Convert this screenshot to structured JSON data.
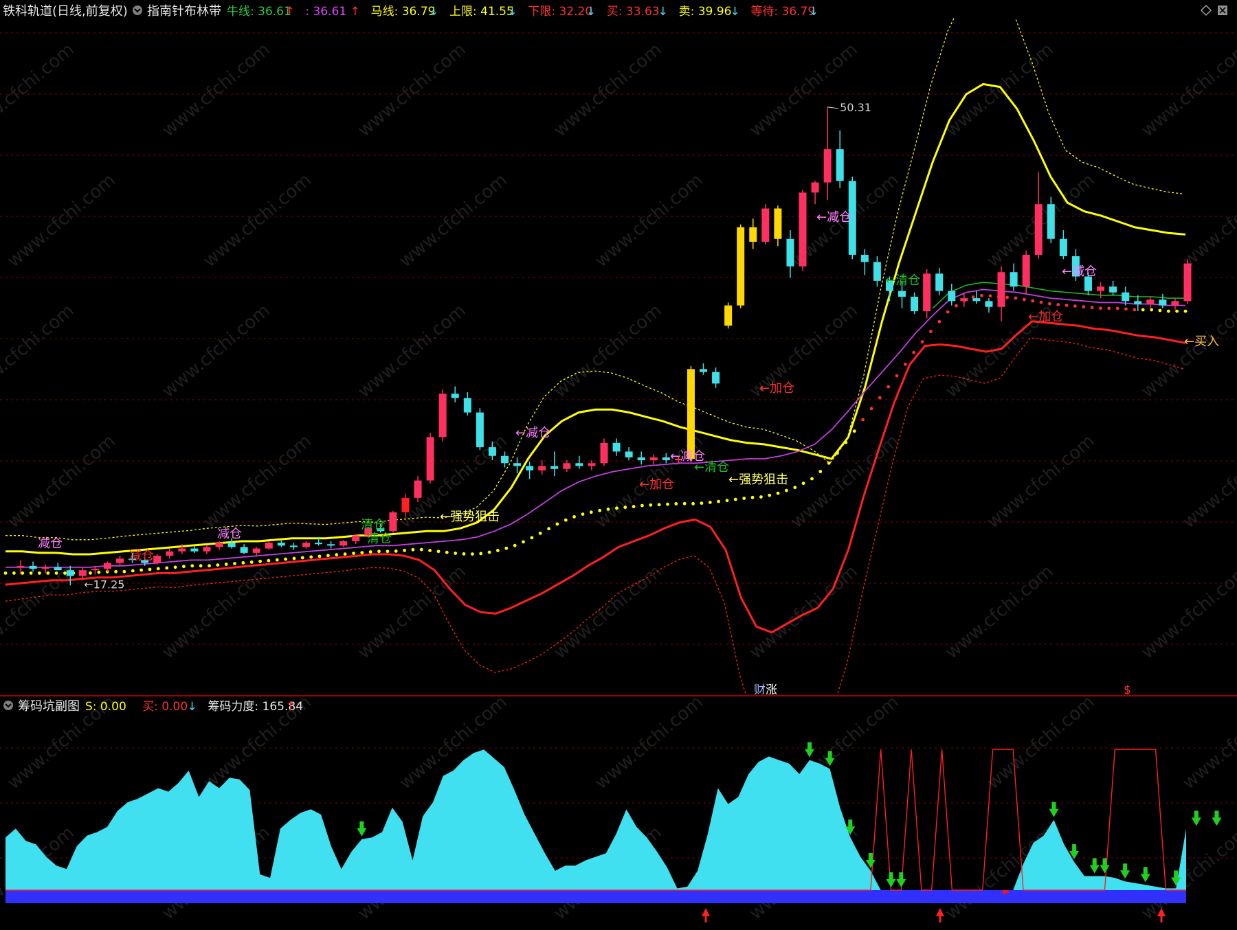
{
  "app": {
    "title": "铁科轨道(日线,前复权)"
  },
  "main_header": {
    "indicator_name": "指南针布林带",
    "items": [
      {
        "label": "牛线",
        "value": ": 36.61",
        "arrow": "↑",
        "color": "#2ecc40",
        "arrow_color": "#ff3030"
      },
      {
        "label": "",
        "value": ": 36.61",
        "arrow": "↑",
        "color": "#e040fb",
        "arrow_color": "#ff3030"
      },
      {
        "label": "马线",
        "value": ": 36.79",
        "arrow": "↓",
        "color": "#ffff00",
        "arrow_color": "#40e0ff"
      },
      {
        "label": "上限",
        "value": ": 41.55",
        "arrow": "↓",
        "color": "#ffff00",
        "arrow_color": "#40e0ff"
      },
      {
        "label": "下限",
        "value": ": 32.20",
        "arrow": "↓",
        "color": "#ff3030",
        "arrow_color": "#40e0ff"
      },
      {
        "label": "买",
        "value": ": 33.63",
        "arrow": "↓",
        "color": "#ff3030",
        "arrow_color": "#40e0ff"
      },
      {
        "label": "卖",
        "value": ": 39.96",
        "arrow": "↓",
        "color": "#ffff00",
        "arrow_color": "#40e0ff"
      },
      {
        "label": "等待",
        "value": ": 36.79",
        "arrow": "↓",
        "color": "#ff3030",
        "arrow_color": "#40e0ff"
      }
    ]
  },
  "sub_header": {
    "indicator_name": "筹码坑副图",
    "items": [
      {
        "label": "S",
        "value": ": 0.00",
        "arrow": "",
        "color": "#ffff00"
      },
      {
        "label": "买",
        "value": ": 0.00",
        "arrow": "↓",
        "color": "#ff3030",
        "arrow_color": "#40e0ff"
      },
      {
        "label": "筹码力度",
        "value": ": 165.84",
        "arrow": "↑",
        "color": "#e8e8e8",
        "arrow_color": "#ff3030"
      }
    ]
  },
  "watermark": "www.cfchi.com",
  "colors": {
    "background": "#000000",
    "up_candle": "#ff3060",
    "down_candle": "#40e0e8",
    "yellow_candle": "#ffd800",
    "upper_band": "#ffff00",
    "lower_band": "#ff2020",
    "magenta_line": "#c040e0",
    "green_line": "#20c020",
    "dotted_line": "#ffff00",
    "grid": "#8b0000",
    "area_fill": "#40e0f0",
    "blue_bar": "#3030ff",
    "red_area": "#ff1010"
  },
  "chart_data": [
    {
      "type": "candlestick",
      "title": "指南针布林带",
      "ylim": [
        10,
        56
      ],
      "price_labels": [
        {
          "text": "50.31"
        },
        {
          "text": "17.25"
        }
      ],
      "candles": [
        [
          18.5,
          19.0,
          18.0,
          18.6
        ],
        [
          18.6,
          18.9,
          18.2,
          18.4
        ],
        [
          18.4,
          18.7,
          18.1,
          18.5
        ],
        [
          18.5,
          18.8,
          18.3,
          18.3
        ],
        [
          18.3,
          18.6,
          17.25,
          17.9
        ],
        [
          17.9,
          18.5,
          17.6,
          18.3
        ],
        [
          18.3,
          18.6,
          18.0,
          18.4
        ],
        [
          18.4,
          18.9,
          18.2,
          18.8
        ],
        [
          18.8,
          19.3,
          18.6,
          19.1
        ],
        [
          19.1,
          19.5,
          18.8,
          19.0
        ],
        [
          19.0,
          19.2,
          18.6,
          18.8
        ],
        [
          18.8,
          19.4,
          18.7,
          19.3
        ],
        [
          19.3,
          19.8,
          19.1,
          19.6
        ],
        [
          19.6,
          20.1,
          19.4,
          19.8
        ],
        [
          19.8,
          20.0,
          19.5,
          19.6
        ],
        [
          19.6,
          20.0,
          19.4,
          19.9
        ],
        [
          19.9,
          20.3,
          19.7,
          20.2
        ],
        [
          20.2,
          20.5,
          19.8,
          19.9
        ],
        [
          19.9,
          20.1,
          19.4,
          19.5
        ],
        [
          19.5,
          19.9,
          19.3,
          19.8
        ],
        [
          19.8,
          20.3,
          19.7,
          20.2
        ],
        [
          20.2,
          20.4,
          19.9,
          20.0
        ],
        [
          20.0,
          20.2,
          19.7,
          19.9
        ],
        [
          19.9,
          20.3,
          19.8,
          20.2
        ],
        [
          20.2,
          20.6,
          20.0,
          20.1
        ],
        [
          20.1,
          20.3,
          19.8,
          20.0
        ],
        [
          20.0,
          20.4,
          19.9,
          20.3
        ],
        [
          20.3,
          20.8,
          20.1,
          20.7
        ],
        [
          20.7,
          21.3,
          20.5,
          21.2
        ],
        [
          21.2,
          21.5,
          20.9,
          21.0
        ],
        [
          21.0,
          22.4,
          20.9,
          22.3
        ],
        [
          22.3,
          23.6,
          22.0,
          23.3
        ],
        [
          23.3,
          24.8,
          23.0,
          24.5
        ],
        [
          24.5,
          27.8,
          24.3,
          27.5
        ],
        [
          27.5,
          30.8,
          27.2,
          30.5
        ],
        [
          30.5,
          31.0,
          29.9,
          30.2
        ],
        [
          30.2,
          30.6,
          29.0,
          29.2
        ],
        [
          29.2,
          29.5,
          26.6,
          26.8
        ],
        [
          26.8,
          27.2,
          25.9,
          26.2
        ],
        [
          26.2,
          26.5,
          25.4,
          25.7
        ],
        [
          25.7,
          26.1,
          25.0,
          25.5
        ],
        [
          25.5,
          25.8,
          24.6,
          25.2
        ],
        [
          25.2,
          25.9,
          24.9,
          25.5
        ],
        [
          25.5,
          26.5,
          24.8,
          25.3
        ],
        [
          25.3,
          25.9,
          25.1,
          25.7
        ],
        [
          25.7,
          26.2,
          25.3,
          25.5
        ],
        [
          25.5,
          25.9,
          25.2,
          25.7
        ],
        [
          25.7,
          27.4,
          25.5,
          27.1
        ],
        [
          27.1,
          27.4,
          26.2,
          26.5
        ],
        [
          26.5,
          26.8,
          25.9,
          26.1
        ],
        [
          26.1,
          26.5,
          25.6,
          25.9
        ],
        [
          25.9,
          26.3,
          25.6,
          26.1
        ],
        [
          26.1,
          26.4,
          25.7,
          25.9
        ],
        [
          25.9,
          26.2,
          25.7,
          26.0
        ],
        [
          26.0,
          32.4,
          25.8,
          32.2
        ],
        [
          32.2,
          32.6,
          31.8,
          32.0
        ],
        [
          32.0,
          32.3,
          30.9,
          31.2
        ],
        [
          35.2,
          36.8,
          35.0,
          36.6
        ],
        [
          36.6,
          42.2,
          36.4,
          42.0
        ],
        [
          42.0,
          42.6,
          40.5,
          41.0
        ],
        [
          41.0,
          43.6,
          40.8,
          43.3
        ],
        [
          43.3,
          43.5,
          40.7,
          41.2
        ],
        [
          41.2,
          41.8,
          38.5,
          39.3
        ],
        [
          39.3,
          44.6,
          39.0,
          44.4
        ],
        [
          44.4,
          45.2,
          43.6,
          45.1
        ],
        [
          45.1,
          50.31,
          43.9,
          47.4
        ],
        [
          47.4,
          48.7,
          44.7,
          45.2
        ],
        [
          45.2,
          45.5,
          39.8,
          40.1
        ],
        [
          40.1,
          40.5,
          38.7,
          39.6
        ],
        [
          39.6,
          40.0,
          37.9,
          38.3
        ],
        [
          38.3,
          38.6,
          36.9,
          37.6
        ],
        [
          37.6,
          38.3,
          36.4,
          37.2
        ],
        [
          37.2,
          37.5,
          36.0,
          36.2
        ],
        [
          36.2,
          39.1,
          35.7,
          38.8
        ],
        [
          38.8,
          39.2,
          37.3,
          37.6
        ],
        [
          37.6,
          38.1,
          36.6,
          36.9
        ],
        [
          36.9,
          37.5,
          36.5,
          37.1
        ],
        [
          37.1,
          37.6,
          36.7,
          36.9
        ],
        [
          36.9,
          37.1,
          36.1,
          36.5
        ],
        [
          36.5,
          39.3,
          35.5,
          38.9
        ],
        [
          38.9,
          39.5,
          37.6,
          37.9
        ],
        [
          37.9,
          40.4,
          37.4,
          40.1
        ],
        [
          40.1,
          45.8,
          39.8,
          43.6
        ],
        [
          43.6,
          44.1,
          40.9,
          41.2
        ],
        [
          41.2,
          41.8,
          39.8,
          40.0
        ],
        [
          40.0,
          40.5,
          38.3,
          38.6
        ],
        [
          38.6,
          38.9,
          37.3,
          37.6
        ],
        [
          37.6,
          38.2,
          37.1,
          37.9
        ],
        [
          37.9,
          38.3,
          37.3,
          37.5
        ],
        [
          37.5,
          37.9,
          36.6,
          36.9
        ],
        [
          36.9,
          37.3,
          36.2,
          36.7
        ],
        [
          36.7,
          37.2,
          36.3,
          37.0
        ],
        [
          37.0,
          37.4,
          36.4,
          36.6
        ],
        [
          36.6,
          37.1,
          36.3,
          36.9
        ],
        [
          36.9,
          39.8,
          36.7,
          39.5
        ]
      ],
      "series": [
        {
          "name": "上限",
          "values": [
            19.6,
            19.6,
            19.5,
            19.5,
            19.4,
            19.4,
            19.5,
            19.6,
            19.7,
            19.8,
            19.9,
            20.0,
            20.1,
            20.2,
            20.3,
            20.3,
            20.4,
            20.5,
            20.5,
            20.5,
            20.6,
            20.7,
            20.7,
            20.8,
            20.9,
            21.0,
            21.0,
            21.2,
            21.6,
            22.5,
            24.0,
            26.0,
            27.6,
            28.6,
            29.2,
            29.4,
            29.4,
            29.2,
            28.9,
            28.6,
            28.2,
            27.9,
            27.6,
            27.3,
            27.1,
            27.0,
            26.8,
            26.6,
            26.3,
            26.0,
            27.5,
            31.0,
            35.5,
            39.5,
            43.0,
            46.5,
            49.4,
            51.2,
            51.9,
            51.7,
            50.2,
            48.0,
            45.5,
            43.7,
            43.1,
            42.8,
            42.4,
            42.0,
            41.8,
            41.6,
            41.5
          ]
        },
        {
          "name": "下限",
          "values": [
            17.3,
            17.4,
            17.5,
            17.6,
            17.6,
            17.7,
            17.8,
            17.8,
            17.9,
            18.0,
            18.1,
            18.1,
            18.2,
            18.3,
            18.4,
            18.5,
            18.6,
            18.7,
            18.8,
            18.9,
            19.0,
            19.1,
            19.2,
            19.3,
            19.4,
            19.4,
            19.3,
            19.0,
            18.3,
            17.0,
            15.9,
            15.4,
            15.3,
            15.7,
            16.2,
            16.7,
            17.3,
            17.9,
            18.6,
            19.2,
            19.9,
            20.3,
            20.7,
            21.2,
            21.6,
            21.8,
            21.3,
            19.7,
            16.4,
            14.4,
            14.0,
            14.6,
            15.2,
            15.7,
            17.0,
            19.7,
            23.4,
            26.7,
            29.9,
            32.5,
            33.8,
            33.9,
            33.8,
            33.6,
            33.4,
            33.6,
            34.6,
            35.5,
            35.4,
            35.3,
            35.2,
            35.0,
            34.9,
            34.7,
            34.5,
            34.4,
            34.2,
            34.0
          ]
        },
        {
          "name": "牛线",
          "values": [
            18.5,
            18.5,
            18.5,
            18.5,
            18.5,
            18.5,
            18.6,
            18.6,
            18.7,
            18.8,
            18.9,
            19.0,
            19.0,
            19.1,
            19.2,
            19.3,
            19.4,
            19.5,
            19.6,
            19.7,
            19.8,
            19.9,
            20.0,
            20.0,
            20.1,
            20.2,
            20.3,
            20.4,
            20.6,
            21.0,
            21.5,
            22.2,
            23.0,
            23.8,
            24.4,
            24.8,
            25.1,
            25.3,
            25.5,
            25.6,
            25.7,
            25.7,
            25.8,
            25.9,
            26.0,
            26.0,
            26.2,
            26.5,
            27.0,
            28.0,
            29.3,
            30.7,
            32.0,
            33.3,
            34.7,
            35.9,
            37.0,
            37.5,
            37.7,
            37.6,
            37.5,
            37.3,
            37.1,
            37.0,
            36.9,
            36.8,
            36.8,
            36.7,
            36.7,
            36.6,
            36.6
          ]
        }
      ],
      "annotations": [
        {
          "text": "减仓",
          "color": "#ff80ff"
        },
        {
          "text": "减仓",
          "color": "#ff80ff"
        },
        {
          "text": "清仓",
          "color": "#20c020"
        },
        {
          "text": "减仓",
          "color": "#ff3030"
        },
        {
          "text": "清仓",
          "color": "#20c020"
        },
        {
          "text": "←强势狙击",
          "color": "#ffff60"
        },
        {
          "text": "←减仓",
          "color": "#ff80ff"
        },
        {
          "text": "←减仓",
          "color": "#ff80ff"
        },
        {
          "text": "←清仓",
          "color": "#20c020"
        },
        {
          "text": "←加仓",
          "color": "#ff3030"
        },
        {
          "text": "←强势狙击",
          "color": "#ffff60"
        },
        {
          "text": "←加仓",
          "color": "#ff3030"
        },
        {
          "text": "←减仓",
          "color": "#ff80ff"
        },
        {
          "text": "←清仓",
          "color": "#20c020"
        },
        {
          "text": "←减仓",
          "color": "#ff80ff"
        },
        {
          "text": "←加仓",
          "color": "#ff3030"
        },
        {
          "text": "←买入",
          "color": "#ffc040"
        }
      ],
      "markers": [
        {
          "text": "财",
          "color": "#a0c0ff"
        },
        {
          "text": "涨",
          "color": "#ffffff"
        },
        {
          "text": "$",
          "color": "#ff3030"
        }
      ]
    },
    {
      "type": "area",
      "title": "筹码坑副图",
      "ylim": [
        0,
        100
      ],
      "values": [
        30,
        35,
        28,
        26,
        19,
        14,
        12,
        25,
        31,
        33,
        36,
        45,
        50,
        52,
        55,
        58,
        56,
        61,
        68,
        53,
        62,
        58,
        64,
        63,
        57,
        9,
        7,
        35,
        40,
        44,
        46,
        43,
        25,
        12,
        22,
        29,
        30,
        33,
        47,
        39,
        17,
        42,
        50,
        65,
        68,
        74,
        78,
        80,
        75,
        70,
        57,
        43,
        32,
        21,
        11,
        14,
        14,
        17,
        19,
        21,
        32,
        46,
        36,
        30,
        22,
        13,
        1,
        2,
        11,
        32,
        58,
        49,
        53,
        66,
        73,
        76,
        74,
        72,
        66,
        74,
        72,
        69,
        47,
        30,
        19,
        11,
        0,
        0,
        0,
        0,
        0,
        0,
        0,
        0,
        0,
        0,
        0,
        0,
        0,
        0,
        15,
        27,
        31,
        40,
        26,
        16,
        8,
        8,
        8,
        7,
        5,
        4,
        3,
        2,
        1,
        1,
        35
      ],
      "red_line": [
        0,
        0,
        0,
        0,
        0,
        0,
        0,
        0,
        0,
        0,
        0,
        0,
        0,
        0,
        0,
        0,
        0,
        0,
        0,
        0,
        0,
        0,
        0,
        0,
        0,
        0,
        0,
        0,
        0,
        0,
        0,
        0,
        0,
        0,
        0,
        0,
        0,
        0,
        0,
        0,
        0,
        0,
        0,
        0,
        0,
        0,
        0,
        0,
        0,
        0,
        0,
        0,
        0,
        0,
        0,
        0,
        0,
        0,
        0,
        0,
        0,
        0,
        0,
        0,
        0,
        0,
        0,
        0,
        0,
        0,
        0,
        0,
        0,
        0,
        0,
        0,
        0,
        0,
        0,
        0,
        0,
        0,
        0,
        0,
        0,
        0,
        80,
        0,
        0,
        80,
        0,
        0,
        80,
        0,
        0,
        0,
        0,
        80,
        80,
        80,
        0,
        0,
        0,
        0,
        0,
        0,
        0,
        0,
        0,
        80,
        80,
        80,
        80,
        80,
        0,
        0,
        0
      ],
      "red_dips": [
        {
          "values": [
            3,
            2
          ]
        },
        {
          "values": [
            0,
            8,
            12,
            25,
            14,
            4,
            1,
            0
          ]
        },
        {
          "values": [
            0,
            2,
            3,
            4,
            3,
            0
          ]
        }
      ],
      "down_markers": 16,
      "up_markers": 3
    }
  ]
}
